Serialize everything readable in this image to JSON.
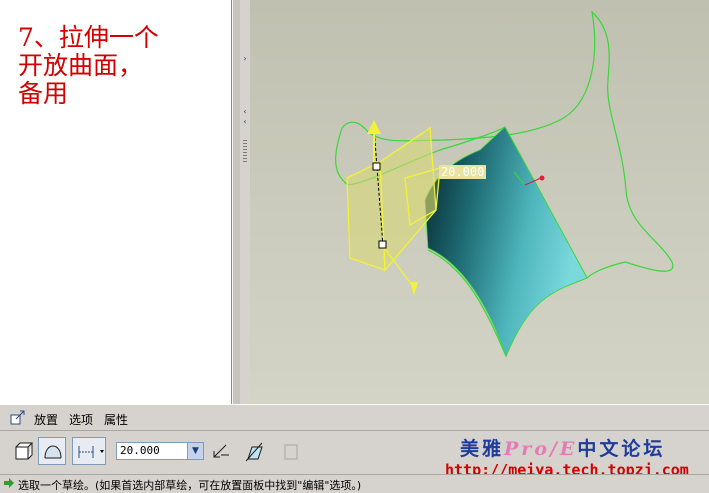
{
  "note": {
    "lines": [
      "7、拉伸一个",
      "开放曲面，",
      "备用"
    ]
  },
  "viewport": {
    "dimension_value": "20.000"
  },
  "dashboard": {
    "tabs": [
      "放置",
      "选项",
      "属性"
    ],
    "depth_value": "20.000"
  },
  "watermark": {
    "brand_part1": "美雅",
    "brand_pe": "Pro/E",
    "brand_part2": "中文论坛",
    "url": "http://meiya.tech.topzj.com"
  },
  "status": {
    "message": "选取一个草绘。(如果首选内部草绘，可在放置面板中找到\"编辑\"选项。)"
  },
  "colors": {
    "note_red": "#d40000",
    "sketch_green": "#3ad63a",
    "preview_yellow": "#f2f23a",
    "surface_cyan": "#6fd3d8"
  }
}
